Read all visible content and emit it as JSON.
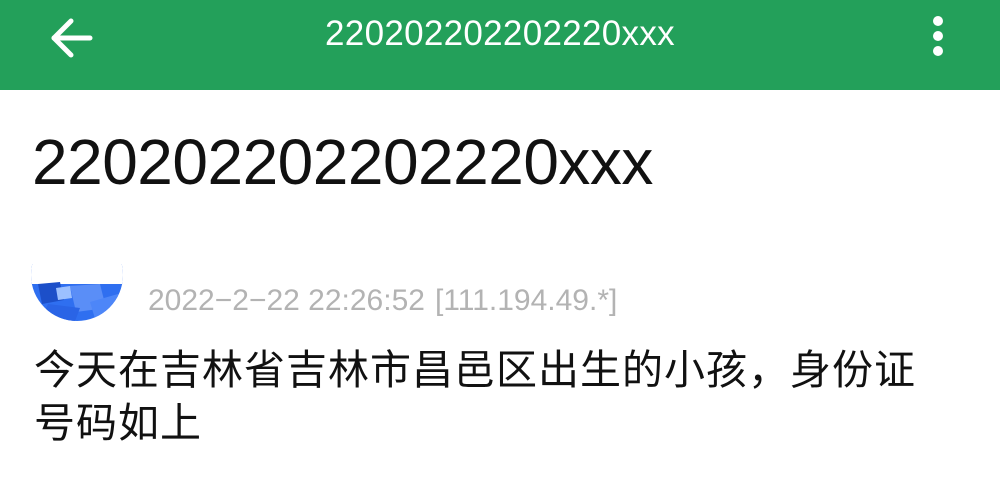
{
  "appbar": {
    "title": "220202202202220xxx",
    "back_icon": "arrow-left-icon",
    "menu_icon": "more-vert-icon",
    "background_color": "#23a05a"
  },
  "post": {
    "title": "220202202202220xxx",
    "avatar_icon": "user-avatar",
    "timestamp": "2022−2−22 22:26:52",
    "ip": "[111.194.49.*]",
    "body": "今天在吉林省吉林市昌邑区出生的小孩，身份证号码如上"
  },
  "colors": {
    "title_text": "#111111",
    "meta_text": "#b3b3b3",
    "avatar_blue": "#1e5adf"
  }
}
